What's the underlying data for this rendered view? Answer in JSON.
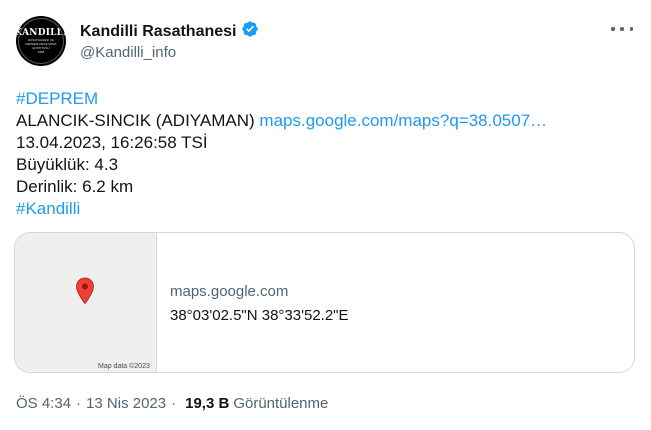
{
  "author": {
    "display_name": "Kandilli Rasathanesi",
    "handle": "@Kandilli_info",
    "avatar_line1": "KANDILLI",
    "avatar_line2": "RASATHANESİ VE",
    "avatar_line3": "DEPREM ARAŞTIRMA",
    "avatar_line4": "ENSTİTÜSÜ",
    "avatar_line5": "1868"
  },
  "tweet": {
    "hashtag1": "#DEPREM",
    "location": "ALANCIK-SINCIK (ADIYAMAN)",
    "link": "maps.google.com/maps?q=38.0507…",
    "datetime": "13.04.2023, 16:26:58 TSİ",
    "magnitude": "Büyüklük: 4.3",
    "depth": "Derinlik: 6.2 km",
    "hashtag2": "#Kandilli"
  },
  "card": {
    "domain": "maps.google.com",
    "title": "38°03'02.5\"N 38°33'52.2\"E",
    "map_attribution": "Map data ©2023"
  },
  "meta": {
    "time": "ÖS 4:34",
    "separator": "·",
    "date": "13 Nis 2023",
    "views": "19,3 B",
    "views_label": "Görüntülenme"
  },
  "colors": {
    "link": "#1d9bf0",
    "verified": "#1d9bf0",
    "pin": "#ea4335"
  },
  "icons": [
    "verified-badge-icon",
    "more-options-icon",
    "map-pin-icon"
  ]
}
